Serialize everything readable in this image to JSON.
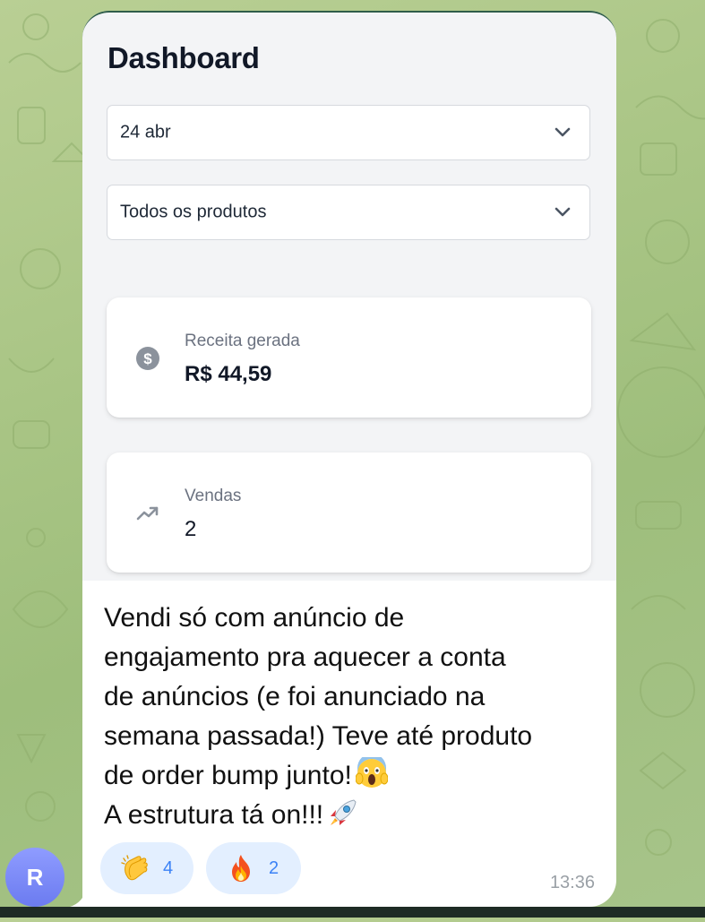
{
  "dashboard": {
    "title": "Dashboard",
    "date_select": {
      "value": "24 abr"
    },
    "product_select": {
      "value": "Todos os produtos"
    },
    "cards": {
      "revenue": {
        "label": "Receita gerada",
        "value": "R$ 44,59",
        "icon": "dollar-circle-icon"
      },
      "sales": {
        "label": "Vendas",
        "value": "2",
        "icon": "trending-up-icon"
      }
    }
  },
  "message": {
    "lines": [
      "Vendi só com anúncio de",
      "engajamento pra aquecer a conta",
      "de anúncios (e foi anunciado na",
      "semana passada!) Teve até produto",
      "de order bump junto!",
      "A estrutura tá on!!!"
    ],
    "emoji_line5": "scream-face-emoji",
    "emoji_line6": "rocket-emoji"
  },
  "reactions": [
    {
      "emoji": "clap-emoji",
      "count": "4"
    },
    {
      "emoji": "fire-emoji",
      "count": "2"
    }
  ],
  "time": "13:36",
  "avatar": {
    "initial": "R",
    "color": "#7b88f5"
  },
  "colors": {
    "reaction_bg": "#e3efff",
    "reaction_count": "#3b82f6",
    "chat_bg": "#a9c585"
  }
}
